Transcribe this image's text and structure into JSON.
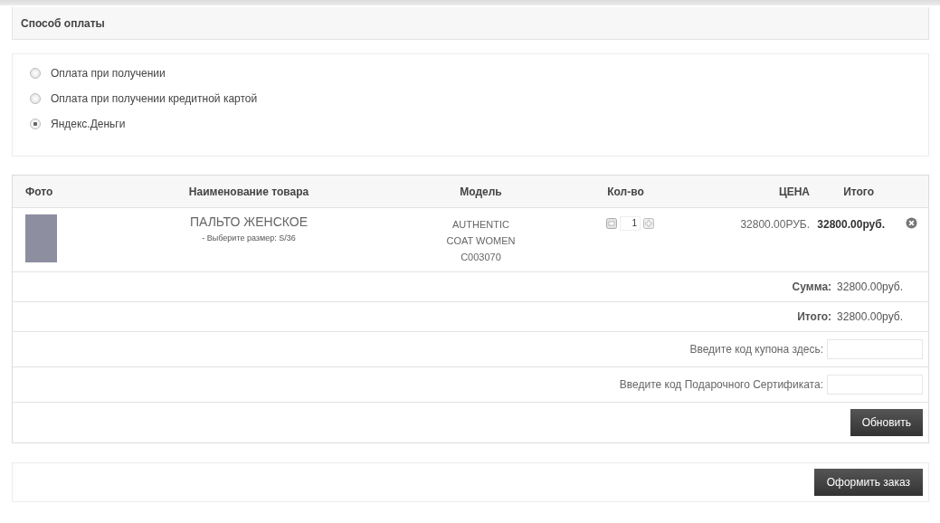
{
  "payment_section": {
    "title": "Способ оплаты",
    "options": [
      {
        "label": "Оплата при получении",
        "selected": false
      },
      {
        "label": "Оплата при получении кредитной картой",
        "selected": false
      },
      {
        "label": "Яндекс.Деньги",
        "selected": true
      }
    ]
  },
  "cart": {
    "columns": [
      "Фото",
      "Наименование товара",
      "Модель",
      "Кол-во",
      "ЦЕНА",
      "Итого"
    ],
    "rows": [
      {
        "name": "ПАЛЬТО ЖЕНСКОЕ",
        "option": "- Выберите размер: S/36",
        "model": [
          "AUTHENTIC",
          "COAT WOMEN",
          "C003070"
        ],
        "quantity": "1",
        "price": "32800.00РУБ.",
        "total": "32800.00руб."
      }
    ],
    "totals": [
      {
        "label": "Сумма:",
        "value": "32800.00руб."
      },
      {
        "label": "Итого:",
        "value": "32800.00руб."
      }
    ],
    "codes": [
      {
        "label": "Введите код купона здесь:"
      },
      {
        "label": "Введите код Подарочного Сертификата:"
      }
    ],
    "update_button": "Обновить"
  },
  "checkout_button": "Оформить заказ"
}
